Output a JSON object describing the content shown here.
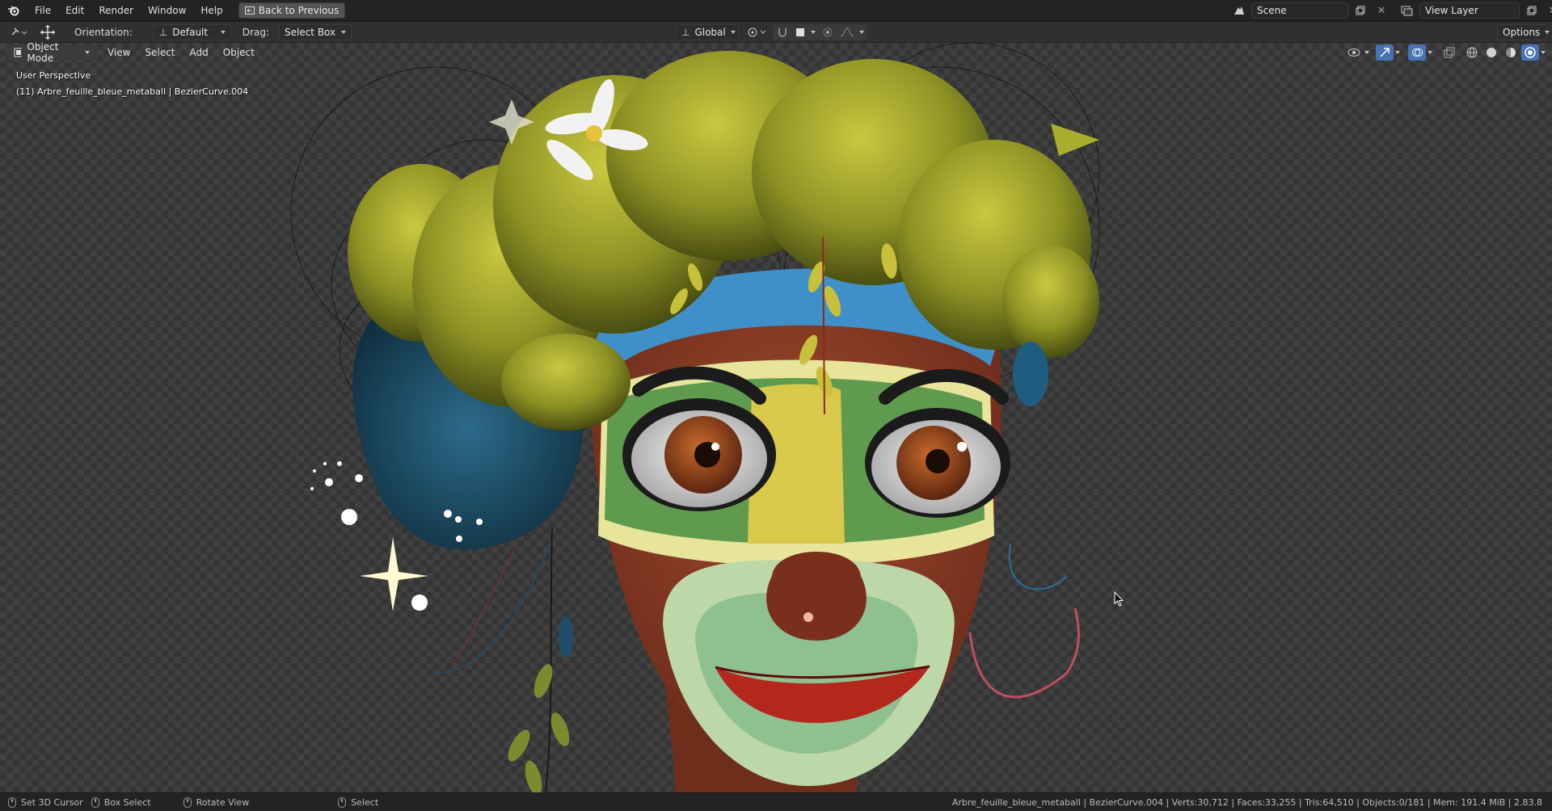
{
  "menubar": {
    "items": [
      "File",
      "Edit",
      "Render",
      "Window",
      "Help"
    ],
    "back_button": "Back to Previous",
    "scene_name": "Scene",
    "view_layer_name": "View Layer"
  },
  "toolheader": {
    "orientation_label": "Orientation:",
    "orientation_value": "Default",
    "drag_label": "Drag:",
    "drag_value": "Select Box",
    "transform_orientation": "Global",
    "options_label": "Options"
  },
  "viewport_header": {
    "mode": "Object Mode",
    "menus": [
      "View",
      "Select",
      "Add",
      "Object"
    ]
  },
  "viewport": {
    "perspective_label": "User Perspective",
    "active_object_label": "(11) Arbre_feuille_bleue_metaball | BezierCurve.004"
  },
  "statusbar": {
    "hints": [
      "Set 3D Cursor",
      "Box Select",
      "Rotate View",
      "Select"
    ],
    "info": "Arbre_feuille_bleue_metaball | BezierCurve.004 | Verts:30,712 | Faces:33,255 | Tris:64,510 | Objects:0/181 | Mem: 191.4 MiB | 2.83.8"
  },
  "icons": {
    "logo": "blender-logo-icon",
    "cursor": "mouse-pointer-icon"
  },
  "colors": {
    "hair": "#a8ad2c",
    "skin": "#8a3d27",
    "face_paint_green": "#5f9a4f",
    "face_paint_yellow": "#d8c94a",
    "headband": "#3f90c9"
  }
}
